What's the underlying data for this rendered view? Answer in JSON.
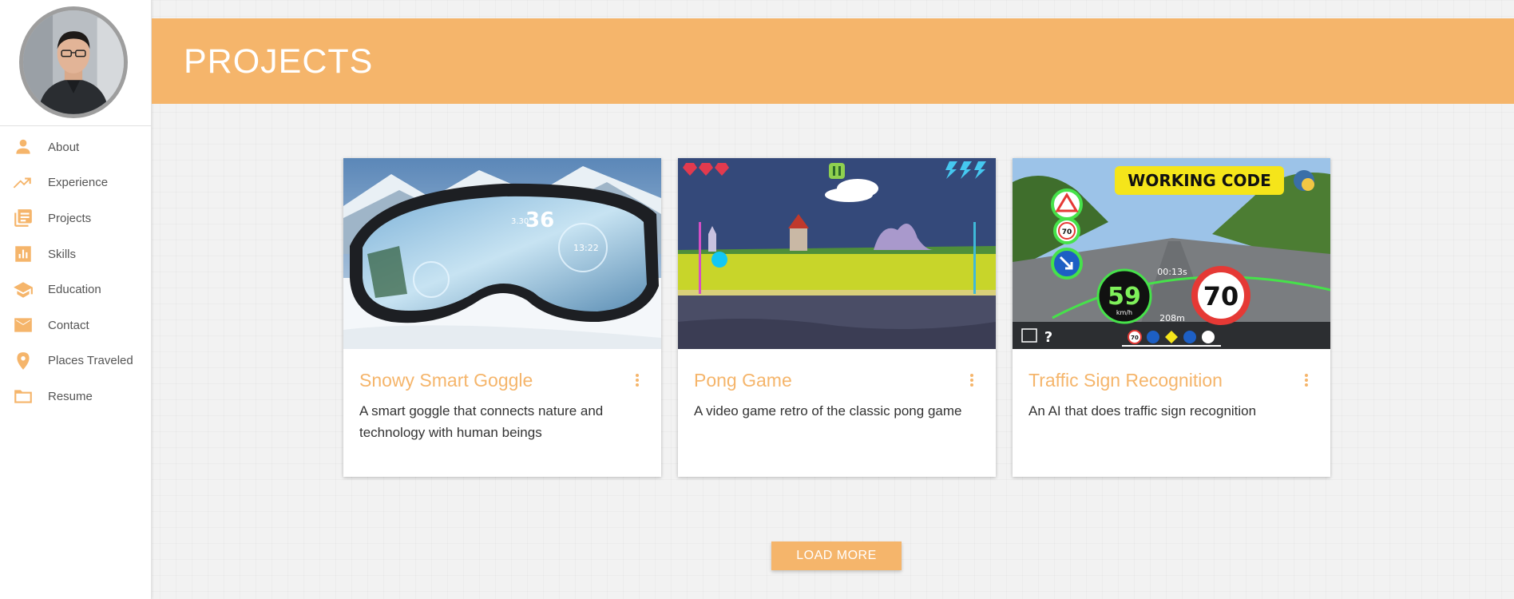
{
  "sidebar": {
    "items": [
      {
        "label": "About",
        "icon": "person-icon"
      },
      {
        "label": "Experience",
        "icon": "trending-up-icon"
      },
      {
        "label": "Projects",
        "icon": "library-books-icon"
      },
      {
        "label": "Skills",
        "icon": "bar-chart-icon"
      },
      {
        "label": "Education",
        "icon": "graduation-cap-icon"
      },
      {
        "label": "Contact",
        "icon": "mail-icon"
      },
      {
        "label": "Places Traveled",
        "icon": "location-pin-icon"
      },
      {
        "label": "Resume",
        "icon": "folder-icon"
      }
    ]
  },
  "header": {
    "title": "PROJECTS"
  },
  "projects": [
    {
      "title": "Snowy Smart Goggle",
      "description": "A smart goggle that connects nature and technology with human beings",
      "image": {
        "hud_speed": "36",
        "hud_time": "13:22",
        "hud_small": "3.30"
      }
    },
    {
      "title": "Pong Game",
      "description": "A video game retro of the classic pong game",
      "image": {}
    },
    {
      "title": "Traffic Sign Recognition",
      "description": "An AI that does traffic sign recognition",
      "image": {
        "banner": "WORKING CODE",
        "speed": "59",
        "speed_unit": "km/h",
        "limit": "70",
        "small_limit": "70",
        "timer": "00:13s",
        "distance": "208m",
        "strip_limit": "70"
      }
    }
  ],
  "load_more": {
    "label": "LOAD MORE"
  },
  "colors": {
    "accent": "#f5b56b",
    "background": "#f2f2f2"
  }
}
